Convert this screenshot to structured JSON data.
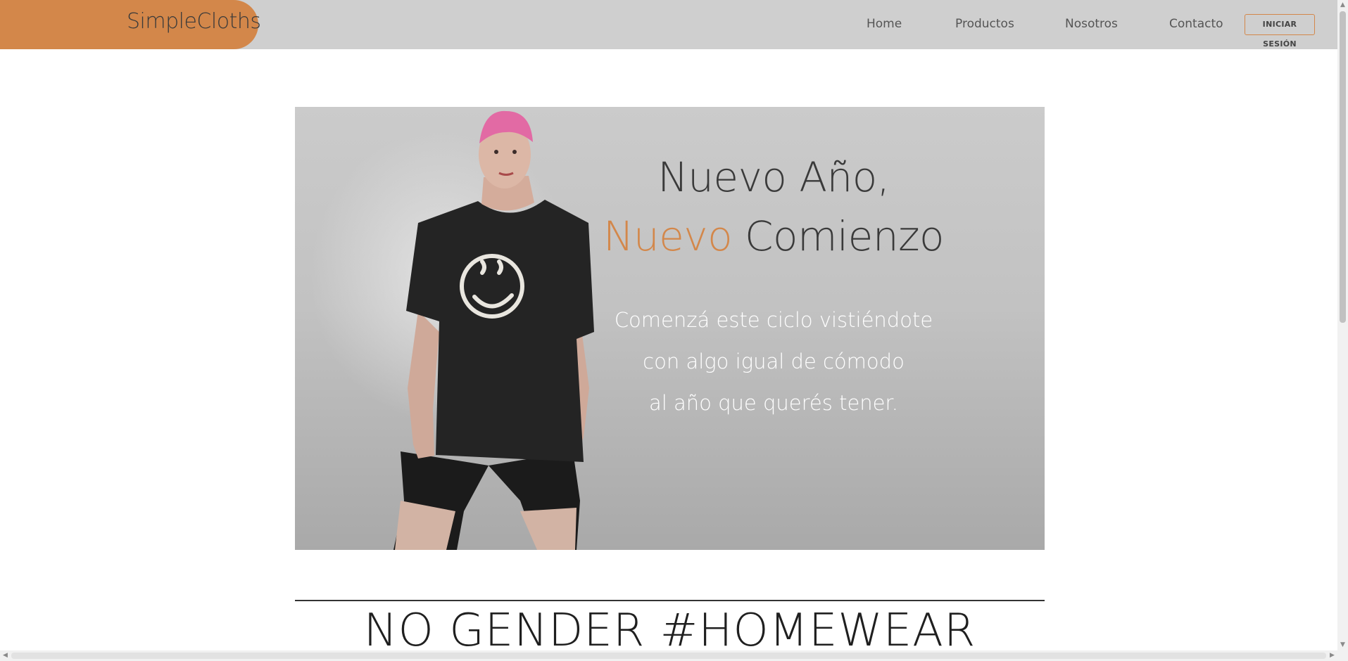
{
  "header": {
    "brand": "SimpleCloths",
    "nav": [
      "Home",
      "Productos",
      "Nosotros",
      "Contacto"
    ],
    "login_label": "INICIAR SESIÓN"
  },
  "hero": {
    "title_line1": "Nuevo Año,",
    "title_accent": "Nuevo",
    "title_rest": " Comienzo",
    "subtitle": [
      "Comenzá este ciclo vistiéndote",
      "con algo igual de cómodo",
      "al año que querés tener."
    ]
  },
  "section": {
    "title": "NO GENDER #HOMEWEAR"
  },
  "colors": {
    "accent": "#d3874a",
    "navbar": "#cfcfcf"
  }
}
